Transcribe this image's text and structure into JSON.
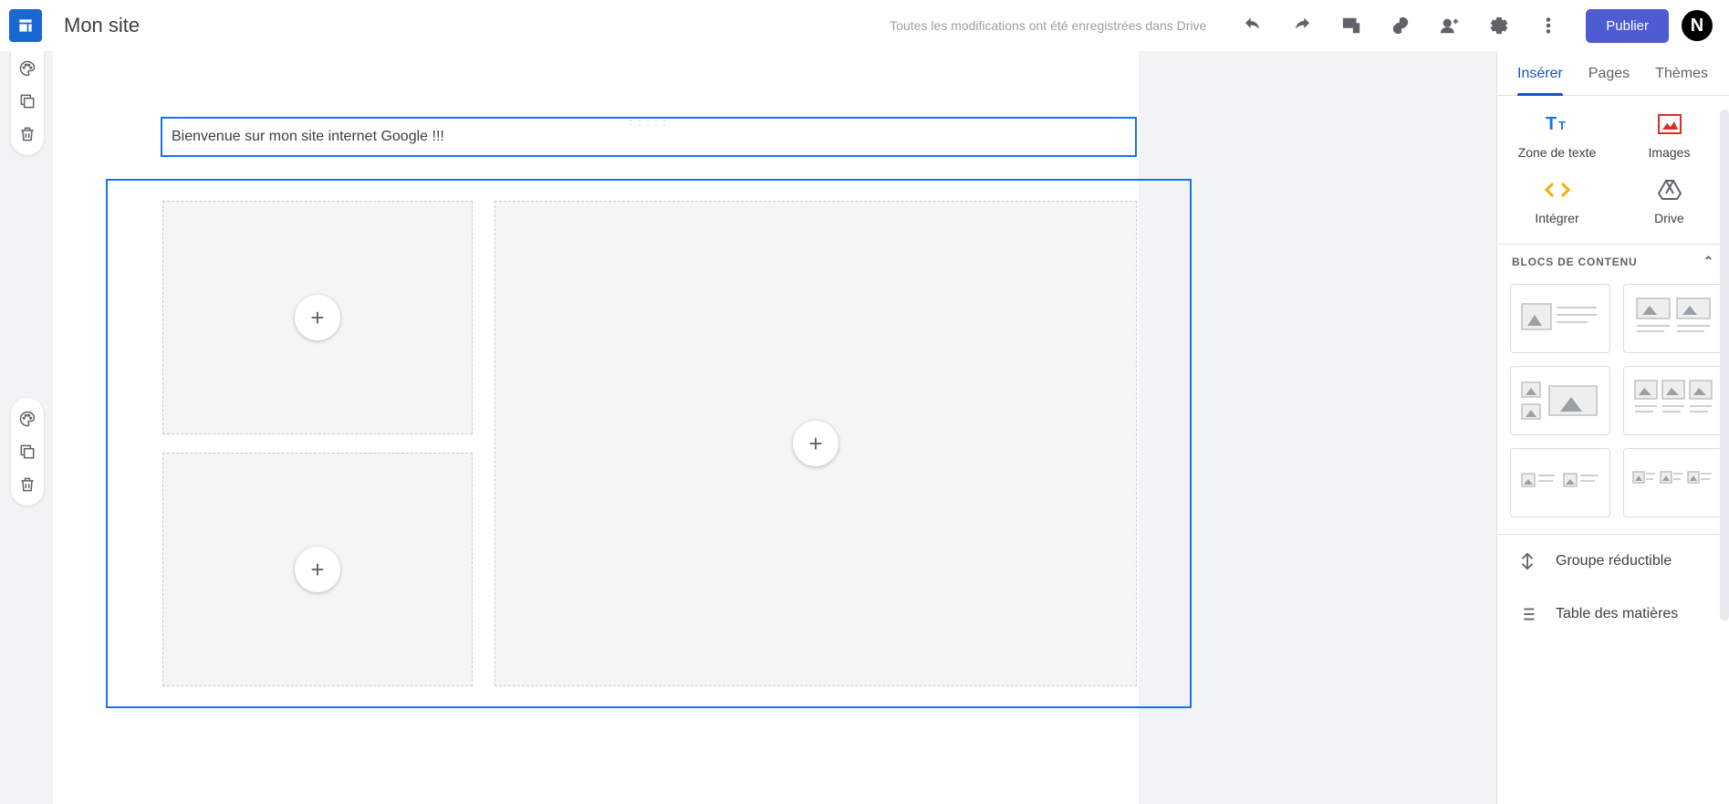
{
  "header": {
    "site_title": "Mon site",
    "save_status": "Toutes les modifications ont été enregistrées dans Drive",
    "publish_label": "Publier",
    "account_initial": "N"
  },
  "canvas": {
    "text_block_content": "Bienvenue sur mon site internet Google !!!"
  },
  "side_panel": {
    "tabs": {
      "insert": "Insérer",
      "pages": "Pages",
      "themes": "Thèmes"
    },
    "insert_items": {
      "text_box": "Zone de texte",
      "images": "Images",
      "embed": "Intégrer",
      "drive": "Drive"
    },
    "blocks_title": "BLOCS DE CONTENU",
    "extras": {
      "collapsible_group": "Groupe réductible",
      "toc": "Table des matières"
    }
  }
}
